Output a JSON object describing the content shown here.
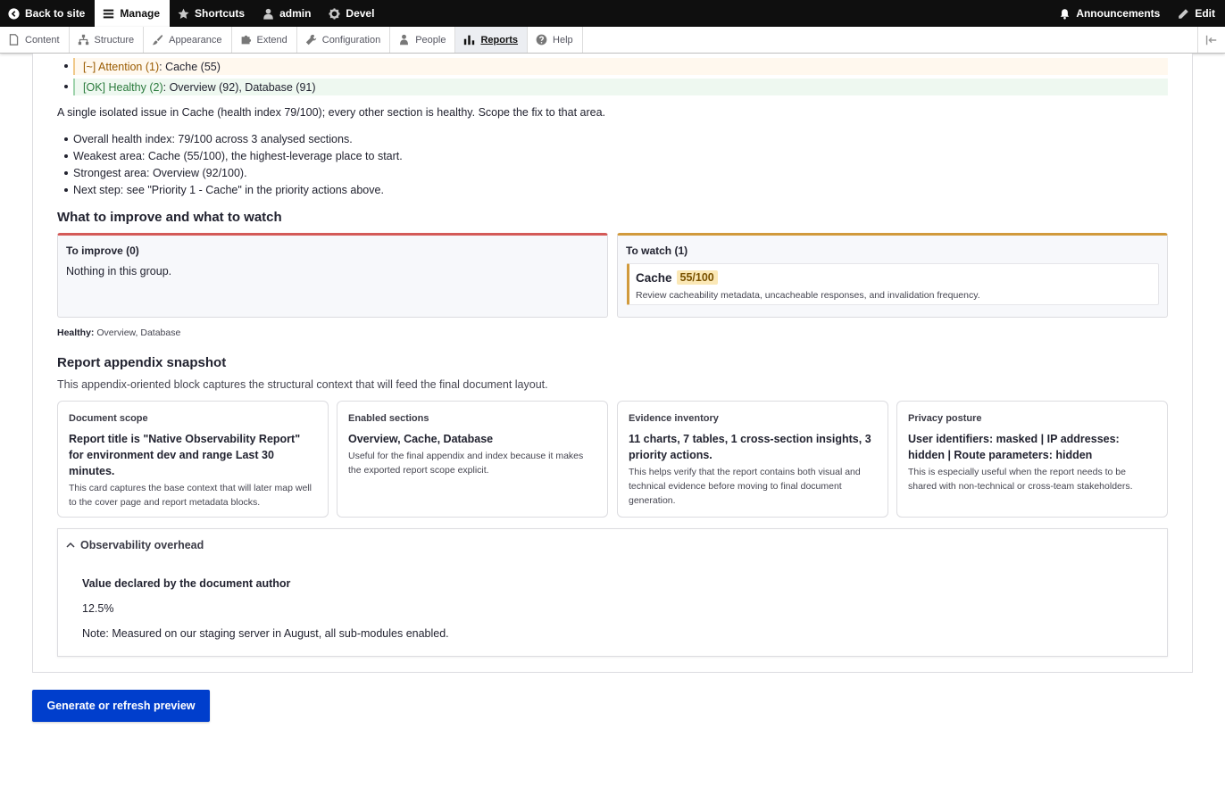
{
  "toolbar": {
    "back_to_site": "Back to site",
    "manage": "Manage",
    "shortcuts": "Shortcuts",
    "user": "admin",
    "devel": "Devel",
    "announcements": "Announcements",
    "edit": "Edit"
  },
  "tray": {
    "items": [
      "Content",
      "Structure",
      "Appearance",
      "Extend",
      "Configuration",
      "People",
      "Reports",
      "Help"
    ],
    "active": "Reports"
  },
  "status_list": {
    "attention": {
      "label": "[~] Attention (1)",
      "rest": ": Cache (55)"
    },
    "ok": {
      "label": "[OK] Healthy (2)",
      "rest": ": Overview (92), Database (91)"
    }
  },
  "summary": {
    "text": "A single isolated issue in Cache (health index 79/100); every other section is healthy. Scope the fix to that area.",
    "bullets": [
      "Overall health index: 79/100 across 3 analysed sections.",
      "Weakest area: Cache (55/100), the highest-leverage place to start.",
      "Strongest area: Overview (92/100).",
      "Next step: see \"Priority 1 - Cache\" in the priority actions above."
    ]
  },
  "improve_watch": {
    "heading": "What to improve and what to watch",
    "improve": {
      "title": "To improve (0)",
      "empty": "Nothing in this group."
    },
    "watch": {
      "title": "To watch (1)",
      "item": {
        "name": "Cache",
        "score": "55/100",
        "desc": "Review cacheability metadata, uncacheable responses, and invalidation frequency."
      }
    },
    "healthy_label": "Healthy:",
    "healthy_value": "Overview, Database"
  },
  "appendix": {
    "heading": "Report appendix snapshot",
    "desc": "This appendix-oriented block captures the structural context that will feed the final document layout.",
    "cards": [
      {
        "label": "Document scope",
        "value": "Report title is \"Native Observability Report\" for environment dev and range Last 30 minutes.",
        "help": "This card captures the base context that will later map well to the cover page and report metadata blocks."
      },
      {
        "label": "Enabled sections",
        "value": "Overview, Cache, Database",
        "help": "Useful for the final appendix and index because it makes the exported report scope explicit."
      },
      {
        "label": "Evidence inventory",
        "value": "11 charts, 7 tables, 1 cross-section insights, 3 priority actions.",
        "help": "This helps verify that the report contains both visual and technical evidence before moving to final document generation."
      },
      {
        "label": "Privacy posture",
        "value": "User identifiers: masked | IP addresses: hidden | Route parameters: hidden",
        "help": "This is especially useful when the report needs to be shared with non-technical or cross-team stakeholders."
      }
    ]
  },
  "overhead": {
    "summary": "Observability overhead",
    "title": "Value declared by the document author",
    "value": "12.5%",
    "note": "Note: Measured on our staging server in August, all sub-modules enabled."
  },
  "actions": {
    "generate": "Generate or refresh preview"
  }
}
